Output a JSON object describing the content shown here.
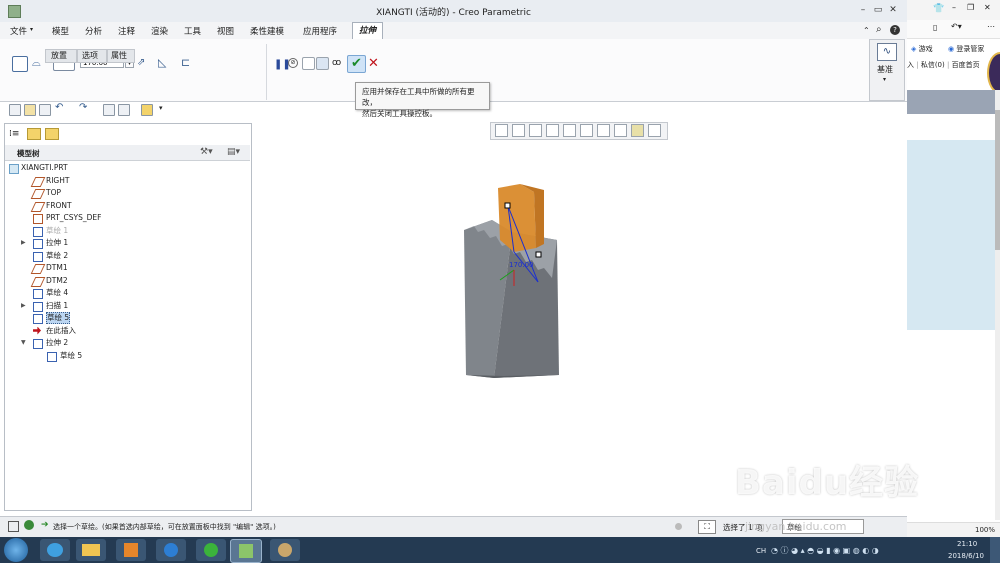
{
  "window": {
    "title": "XIANGTI (活动的) - Creo Parametric"
  },
  "menu": {
    "items": [
      "文件",
      "模型",
      "分析",
      "注释",
      "渲染",
      "工具",
      "视图",
      "柔性建模",
      "应用程序"
    ],
    "active_tab": "拉伸"
  },
  "ribbon": {
    "depth_value": "170.00",
    "subtabs": [
      "放置",
      "选项",
      "属性"
    ],
    "datum_label": "基准"
  },
  "tooltip": {
    "line1": "应用并保存在工具中所做的所有更改，",
    "line2": "然后关闭工具操控板。"
  },
  "model_tree": {
    "header": "模型树",
    "items": [
      {
        "label": "XIANGTI.PRT",
        "indent": 0,
        "icon": "part-icon",
        "expand": ""
      },
      {
        "label": "RIGHT",
        "indent": 1,
        "icon": "datum-plane-icon",
        "expand": ""
      },
      {
        "label": "TOP",
        "indent": 1,
        "icon": "datum-plane-icon",
        "expand": ""
      },
      {
        "label": "FRONT",
        "indent": 1,
        "icon": "datum-plane-icon",
        "expand": ""
      },
      {
        "label": "PRT_CSYS_DEF",
        "indent": 1,
        "icon": "csys-icon",
        "expand": ""
      },
      {
        "label": "草绘 1",
        "indent": 1,
        "icon": "sketch-icon",
        "expand": "",
        "dim": true
      },
      {
        "label": "拉伸 1",
        "indent": 1,
        "icon": "extrude-icon",
        "expand": "▶"
      },
      {
        "label": "草绘 2",
        "indent": 1,
        "icon": "sketch-icon",
        "expand": ""
      },
      {
        "label": "DTM1",
        "indent": 1,
        "icon": "datum-plane-icon",
        "expand": ""
      },
      {
        "label": "DTM2",
        "indent": 1,
        "icon": "datum-plane-icon",
        "expand": ""
      },
      {
        "label": "草绘 4",
        "indent": 1,
        "icon": "sketch-icon",
        "expand": ""
      },
      {
        "label": "扫描 1",
        "indent": 1,
        "icon": "sweep-icon",
        "expand": "▶"
      },
      {
        "label": "草绘 5",
        "indent": 1,
        "icon": "sketch-icon",
        "expand": "",
        "selected": true
      },
      {
        "label": "在此插入",
        "indent": 1,
        "icon": "insert-arrow-icon",
        "expand": ""
      },
      {
        "label": "拉伸 2",
        "indent": 1,
        "icon": "extrude-icon",
        "expand": "▼"
      },
      {
        "label": "草绘 5",
        "indent": 2,
        "icon": "sketch-icon",
        "expand": ""
      }
    ]
  },
  "viewport": {
    "dimension_label": "170.00"
  },
  "status": {
    "message": "选择一个草绘。(如果首选内部草绘，可在放置面板中找到 \"编辑\" 选项。)",
    "selection": "选择了 1 项",
    "filter": "草绘"
  },
  "browser": {
    "games": "游戏",
    "login": "登录管家",
    "links": [
      "入",
      "私信(0)",
      "百度首页"
    ],
    "zoom": "100%"
  },
  "taskbar": {
    "time": "21:10",
    "date": "2018/6/10",
    "lang": "CH"
  },
  "watermark": {
    "text": "Baidu经验",
    "url": "jingyan.baidu.com"
  },
  "colors": {
    "accent_orange": "#d98a2b",
    "model_gray": "#7c8086",
    "taskbar": "#243a52"
  }
}
